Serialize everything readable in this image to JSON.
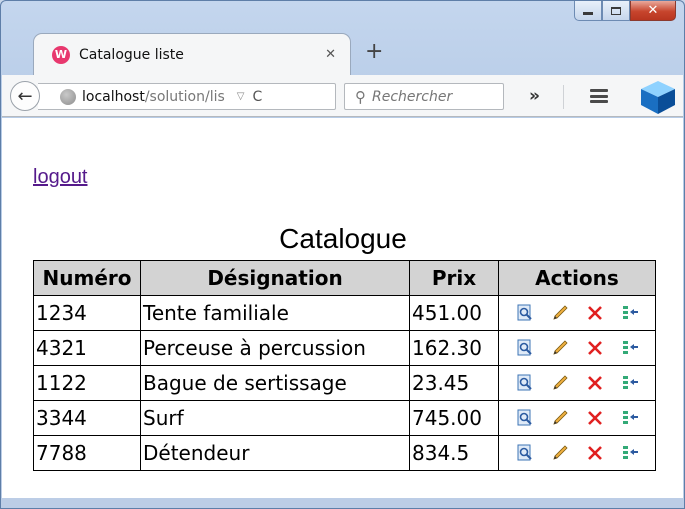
{
  "tab": {
    "title": "Catalogue liste",
    "favicon_letter": "W",
    "close_glyph": "✕"
  },
  "new_tab_glyph": "+",
  "address": {
    "host": "localhost",
    "path": "/solution/lis"
  },
  "search": {
    "placeholder": "Rechercher"
  },
  "toolbar": {
    "overflow_glyph": "»"
  },
  "page": {
    "logout_label": "logout",
    "title": "Catalogue",
    "table": {
      "headers": [
        "Numéro",
        "Désignation",
        "Prix",
        "Actions"
      ],
      "rows": [
        {
          "numero": "1234",
          "designation": "Tente familiale",
          "prix": "451.00"
        },
        {
          "numero": "4321",
          "designation": "Perceuse à percussion",
          "prix": "162.30"
        },
        {
          "numero": "1122",
          "designation": "Bague de sertissage",
          "prix": "23.45"
        },
        {
          "numero": "3344",
          "designation": "Surf",
          "prix": "745.00"
        },
        {
          "numero": "7788",
          "designation": "Détendeur",
          "prix": "834.5"
        }
      ],
      "action_icons": [
        "view-icon",
        "edit-icon",
        "delete-icon",
        "move-icon"
      ]
    }
  },
  "colors": {
    "link_visited": "#551a8b",
    "header_bg": "#d3d3d3",
    "close_red": "#c7452d",
    "favicon": "#e8386e"
  }
}
